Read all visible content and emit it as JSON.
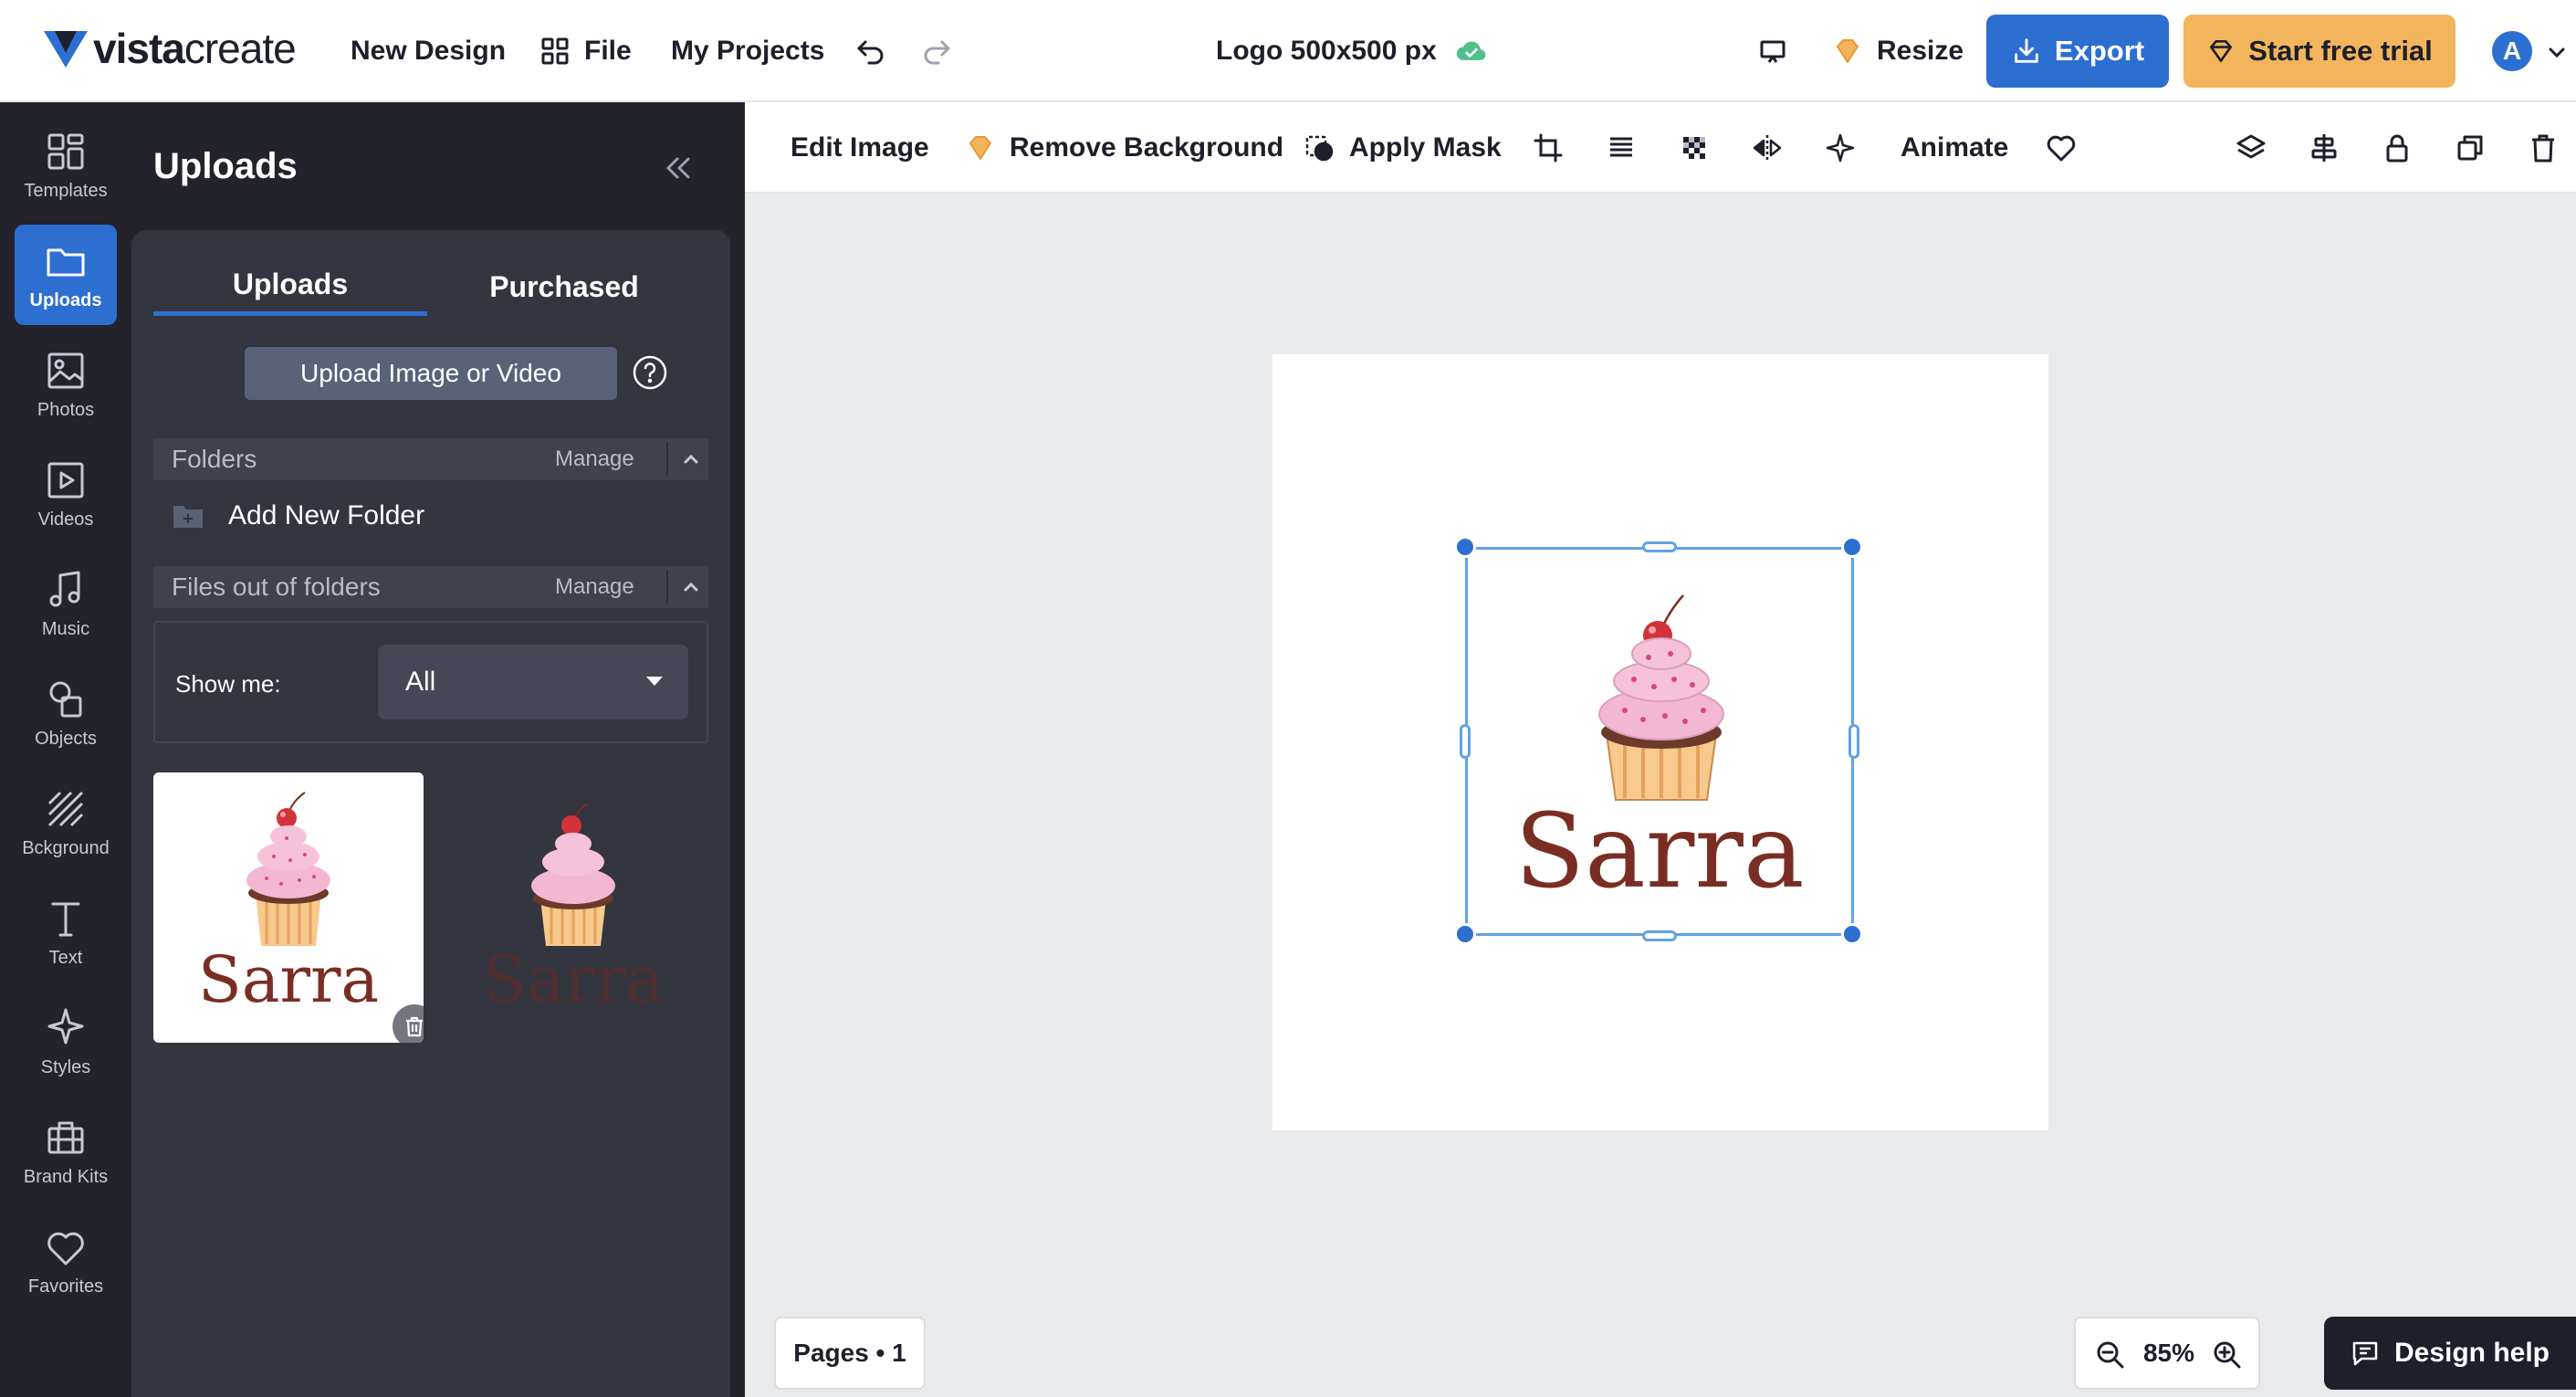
{
  "header": {
    "logo_text_bold": "vista",
    "logo_text_light": "create",
    "new_design": "New Design",
    "file": "File",
    "my_projects": "My Projects",
    "document_title": "Logo 500x500 px",
    "resize": "Resize",
    "export": "Export",
    "start_trial": "Start free trial",
    "avatar_initial": "A"
  },
  "rail": {
    "items": [
      {
        "label": "Templates",
        "icon": "templates-icon"
      },
      {
        "label": "Uploads",
        "icon": "folder-icon",
        "active": true
      },
      {
        "label": "Photos",
        "icon": "photo-icon"
      },
      {
        "label": "Videos",
        "icon": "video-icon"
      },
      {
        "label": "Music",
        "icon": "music-icon"
      },
      {
        "label": "Objects",
        "icon": "objects-icon"
      },
      {
        "label": "Bckground",
        "icon": "background-icon"
      },
      {
        "label": "Text",
        "icon": "text-icon"
      },
      {
        "label": "Styles",
        "icon": "sparkle-icon"
      },
      {
        "label": "Brand Kits",
        "icon": "briefcase-icon"
      },
      {
        "label": "Favorites",
        "icon": "heart-icon"
      }
    ]
  },
  "panel": {
    "title": "Uploads",
    "tabs": [
      "Uploads",
      "Purchased"
    ],
    "upload_button": "Upload Image or Video",
    "folders_label": "Folders",
    "manage_label": "Manage",
    "add_folder": "Add New Folder",
    "files_out_label": "Files out of folders",
    "show_me_label": "Show me:",
    "show_me_value": "All",
    "thumb_word": "Sarra"
  },
  "toolbar": {
    "edit_image": "Edit Image",
    "remove_background": "Remove Background",
    "apply_mask": "Apply Mask",
    "animate": "Animate"
  },
  "canvas": {
    "logo_word": "Sarra"
  },
  "footer": {
    "pages": "Pages • 1",
    "zoom": "85%",
    "design_help": "Design help"
  },
  "colors": {
    "accent": "#2d6fd0",
    "trial": "#f3b55b",
    "panel_bg": "#33353f",
    "rail_bg": "#22232b",
    "logo_text": "#7a2d22"
  }
}
